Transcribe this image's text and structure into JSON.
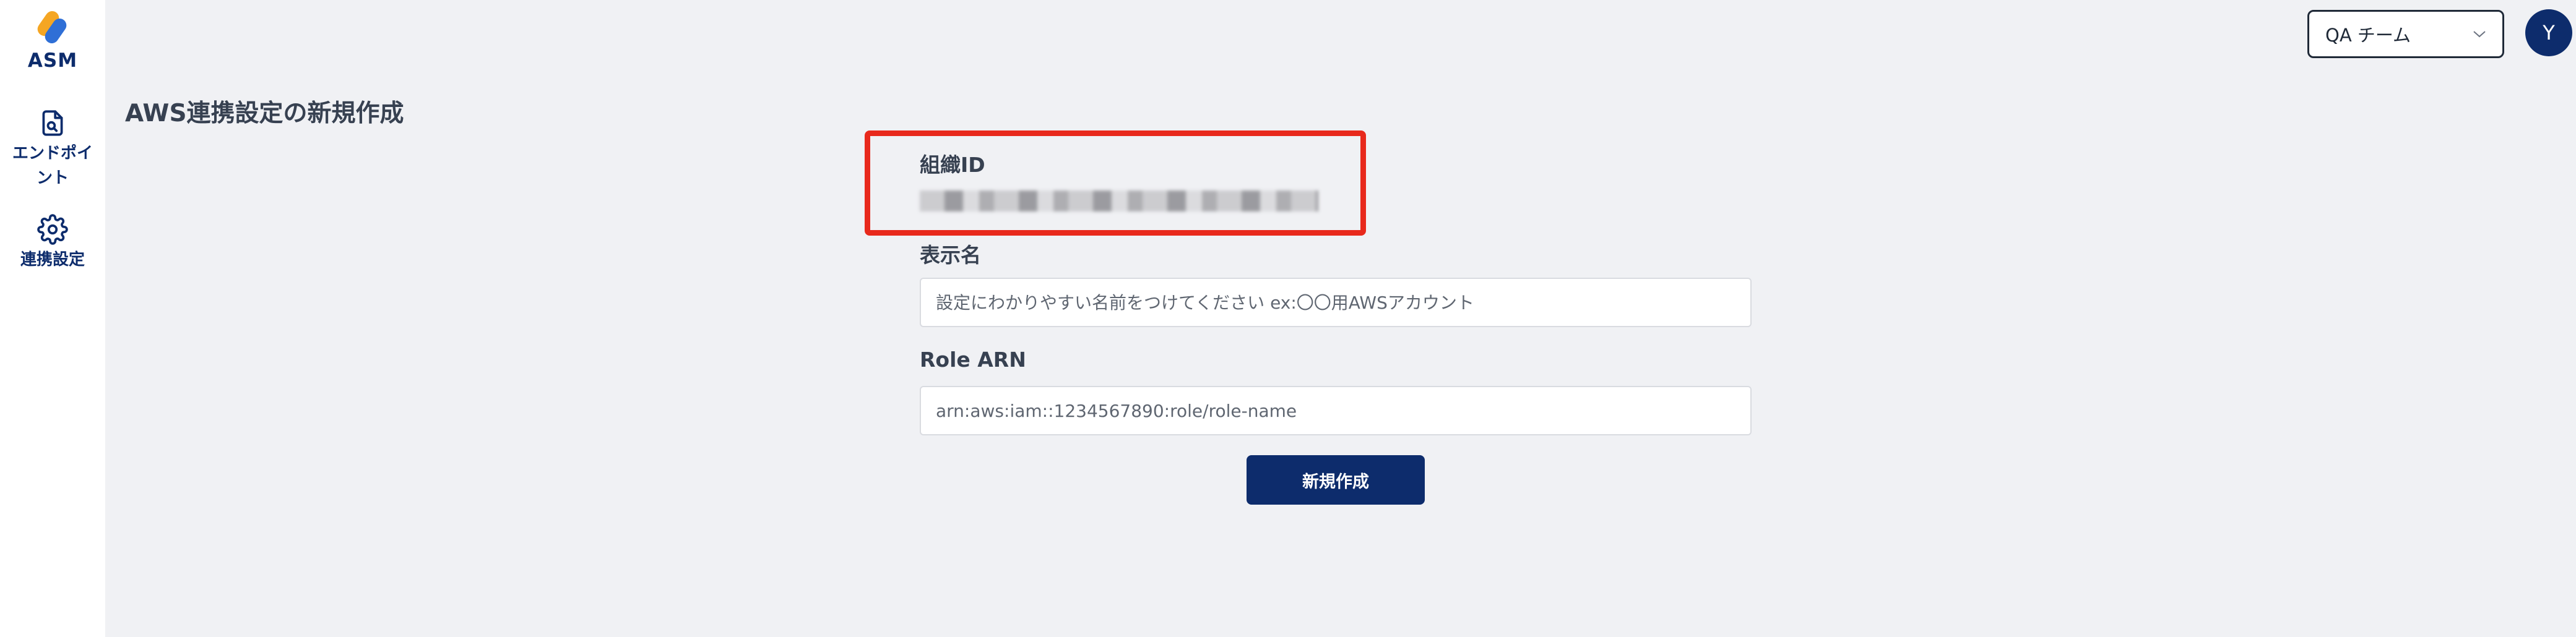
{
  "app": {
    "logo_text": "ASM"
  },
  "sidebar": {
    "items": [
      {
        "label": "エンドポイント",
        "icon": "document-search-icon"
      },
      {
        "label": "連携設定",
        "icon": "gear-icon"
      }
    ]
  },
  "header": {
    "team_select": {
      "selected": "QA チーム"
    },
    "avatar_initial": "Y"
  },
  "main": {
    "title": "AWS連携設定の新規作成",
    "fields": {
      "org_id": {
        "label": "組織ID"
      },
      "display_name": {
        "label": "表示名",
        "placeholder": "設定にわかりやすい名前をつけてください ex:〇〇用AWSアカウント",
        "value": ""
      },
      "role_arn": {
        "label": "Role ARN",
        "placeholder": "arn:aws:iam::1234567890:role/role-name",
        "value": ""
      }
    },
    "submit_label": "新規作成"
  },
  "colors": {
    "brand_navy": "#0d2c6c",
    "highlight_red": "#e8291c",
    "logo_orange": "#f5a623",
    "logo_blue": "#2f6fd6"
  }
}
